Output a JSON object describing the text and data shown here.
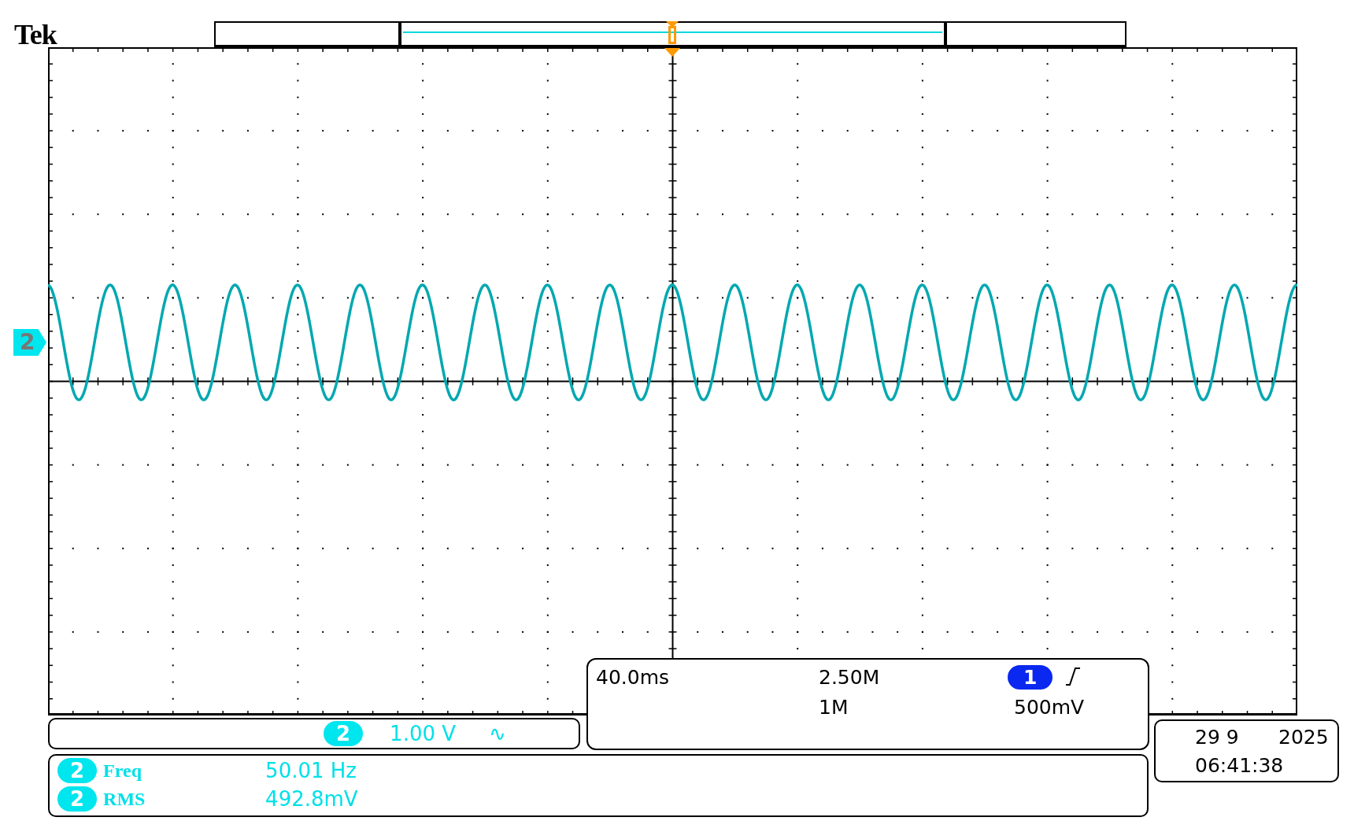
{
  "brand": "Tek",
  "channel_marker": {
    "label": "2"
  },
  "channel_settings": {
    "channel": "2",
    "scale": "1.00 V",
    "coupling": "∿"
  },
  "timebase": {
    "time_per_div": "40.0ms",
    "sample_rate": "2.50M",
    "record_length": "1M",
    "trigger_channel": "1",
    "trigger_level": "500mV"
  },
  "measurements": [
    {
      "channel": "2",
      "name": "Freq",
      "value": "50.01 Hz"
    },
    {
      "channel": "2",
      "name": "RMS",
      "value": "492.8mV"
    }
  ],
  "date": {
    "day_month": "29 9",
    "year": "2025",
    "time": "06:41:38"
  }
}
